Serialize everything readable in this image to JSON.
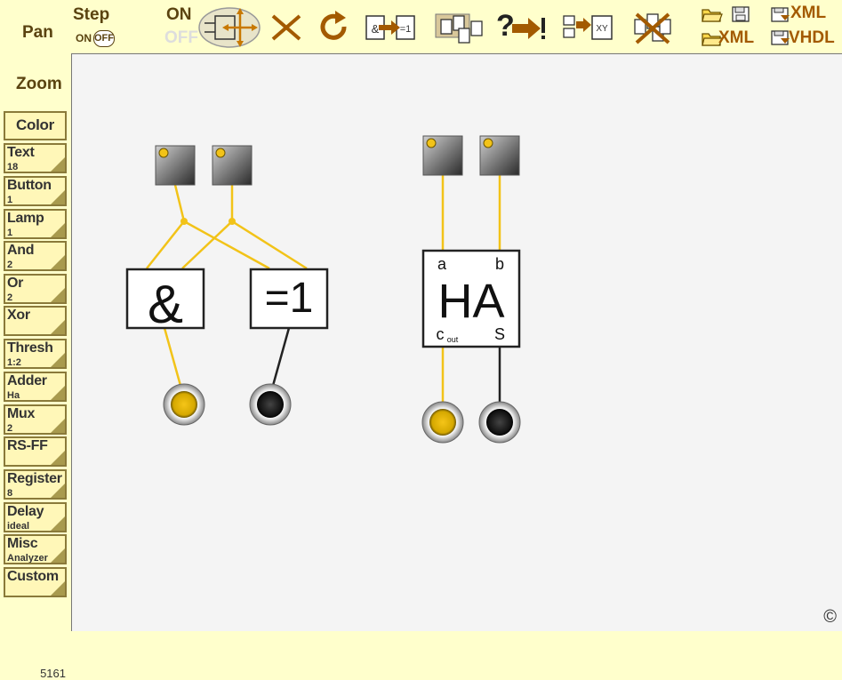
{
  "toolbar": {
    "pan_label": "Pan",
    "step_label": "Step",
    "step_on": "ON",
    "step_off": "OFF",
    "power_on": "ON",
    "power_off": "OFF",
    "xml_save_label": "XML",
    "xml_load_label": "XML",
    "vhdl_label": "VHDL",
    "xor_chip_label": "=1",
    "xy_label": "XY",
    "help_label": "?"
  },
  "sidebar": {
    "zoom_label": "Zoom",
    "color_label": "Color",
    "items": [
      {
        "label": "Text",
        "sub": "18"
      },
      {
        "label": "Button",
        "sub": "1"
      },
      {
        "label": "Lamp",
        "sub": "1"
      },
      {
        "label": "And",
        "sub": "2"
      },
      {
        "label": "Or",
        "sub": "2"
      },
      {
        "label": "Xor",
        "sub": ""
      },
      {
        "label": "Thresh",
        "sub": "1:2"
      },
      {
        "label": "Adder",
        "sub": "Ha"
      },
      {
        "label": "Mux",
        "sub": "2"
      },
      {
        "label": "RS-FF",
        "sub": ""
      },
      {
        "label": "Register",
        "sub": "8"
      },
      {
        "label": "Delay",
        "sub": "ideal"
      },
      {
        "label": "Misc",
        "sub": "Analyzer"
      },
      {
        "label": "Custom",
        "sub": ""
      }
    ],
    "counter": "5161"
  },
  "circuit": {
    "and_gate_label": "&",
    "xor_gate_label": "=1",
    "half_adder": {
      "title": "HA",
      "in_a": "a",
      "in_b": "b",
      "out_carry": "c",
      "out_carry_sub": "out",
      "out_sum": "S"
    },
    "copyright": "©"
  },
  "colors": {
    "background": "#ffffcc",
    "wire_active": "#f2c318",
    "wire_inactive": "#222222",
    "accent": "#9a5a00"
  }
}
